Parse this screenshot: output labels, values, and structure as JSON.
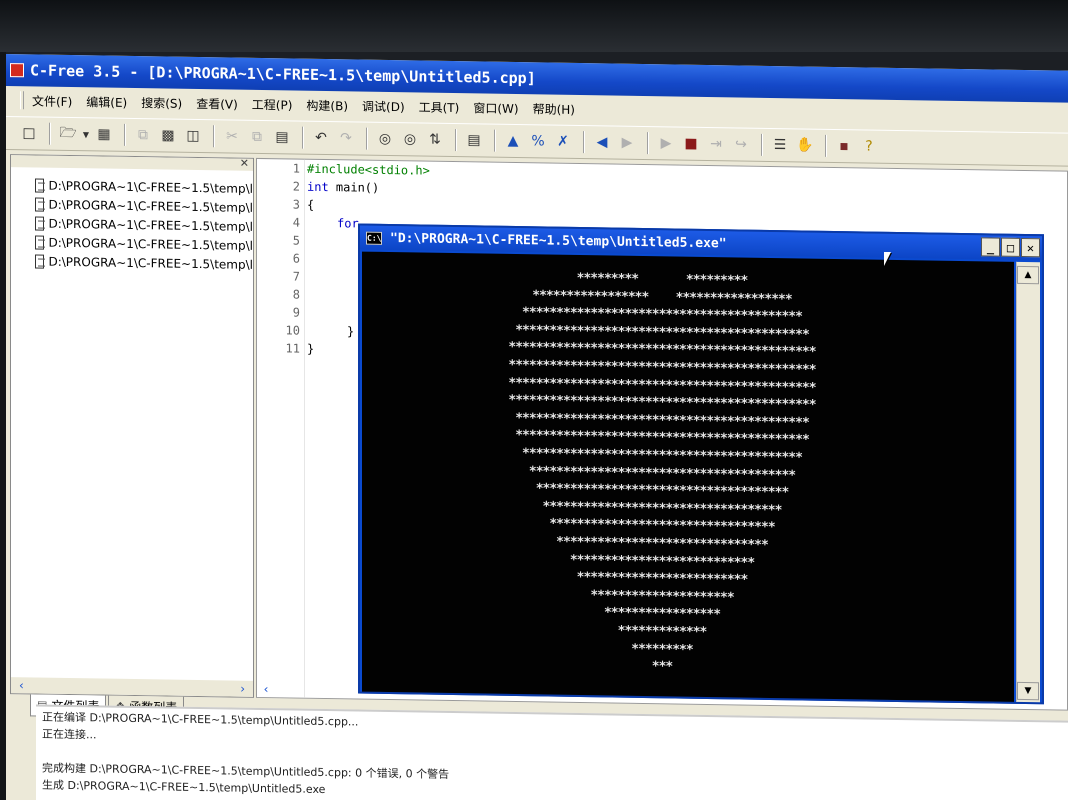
{
  "window": {
    "title": "C-Free 3.5 - [D:\\PROGRA~1\\C-FREE~1.5\\temp\\Untitled5.cpp]"
  },
  "menu": [
    "文件(F)",
    "编辑(E)",
    "搜索(S)",
    "查看(V)",
    "工程(P)",
    "构建(B)",
    "调试(D)",
    "工具(T)",
    "窗口(W)",
    "帮助(H)"
  ],
  "toolbar_icons": [
    "new-file-icon",
    "open-icon",
    "dropdown-icon",
    "project-icon",
    "copy-doc-icon",
    "save-icon",
    "save-all-icon",
    "cut-icon",
    "copy-icon",
    "paste-icon",
    "undo-icon",
    "redo-icon",
    "find-icon",
    "find-next-icon",
    "replace-icon",
    "goto-icon",
    "bookmark-icon",
    "toggle-bookmark-icon",
    "clear-bookmark-icon",
    "back-icon",
    "forward-icon",
    "run-icon",
    "stop-icon",
    "step-icon",
    "step-over-icon",
    "list-icon",
    "hand-icon",
    "book-icon",
    "help-icon"
  ],
  "file_list": [
    "D:\\PROGRA~1\\C-FREE~1.5\\temp\\l",
    "D:\\PROGRA~1\\C-FREE~1.5\\temp\\l",
    "D:\\PROGRA~1\\C-FREE~1.5\\temp\\l",
    "D:\\PROGRA~1\\C-FREE~1.5\\temp\\l",
    "D:\\PROGRA~1\\C-FREE~1.5\\temp\\l"
  ],
  "panel_tabs": [
    "文件列表",
    "函数列表"
  ],
  "editor": {
    "line_numbers": [
      "1",
      "2",
      "3",
      "4",
      "5",
      "6",
      "7",
      "8",
      "9",
      "10",
      "11"
    ],
    "include_line": "#include<stdio.h>",
    "line2_kw": "int",
    "line2_rest": " main()",
    "line3": "{",
    "line4_kw": "for",
    "line10": "}",
    "line11": "}"
  },
  "console": {
    "title": "\"D:\\PROGRA~1\\C-FREE~1.5\\temp\\Untitled5.exe\"",
    "icon_text": "C:\\",
    "output_lines": [
      "*********       *********",
      "*****************    *****************",
      "*****************************************",
      "*******************************************",
      "*********************************************",
      "*********************************************",
      "*********************************************",
      "*********************************************",
      "*******************************************",
      "*******************************************",
      "*****************************************",
      "***************************************",
      "*************************************",
      "***********************************",
      "*********************************",
      "*******************************",
      "***************************",
      "*************************",
      "*********************",
      "*****************",
      "*************",
      "*********",
      "***"
    ]
  },
  "output_log": [
    "正在编译 D:\\PROGRA~1\\C-FREE~1.5\\temp\\Untitled5.cpp...",
    "正在连接...",
    "",
    "完成构建 D:\\PROGRA~1\\C-FREE~1.5\\temp\\Untitled5.cpp: 0 个错误, 0 个警告",
    "生成 D:\\PROGRA~1\\C-FREE~1.5\\temp\\Untitled5.exe"
  ]
}
